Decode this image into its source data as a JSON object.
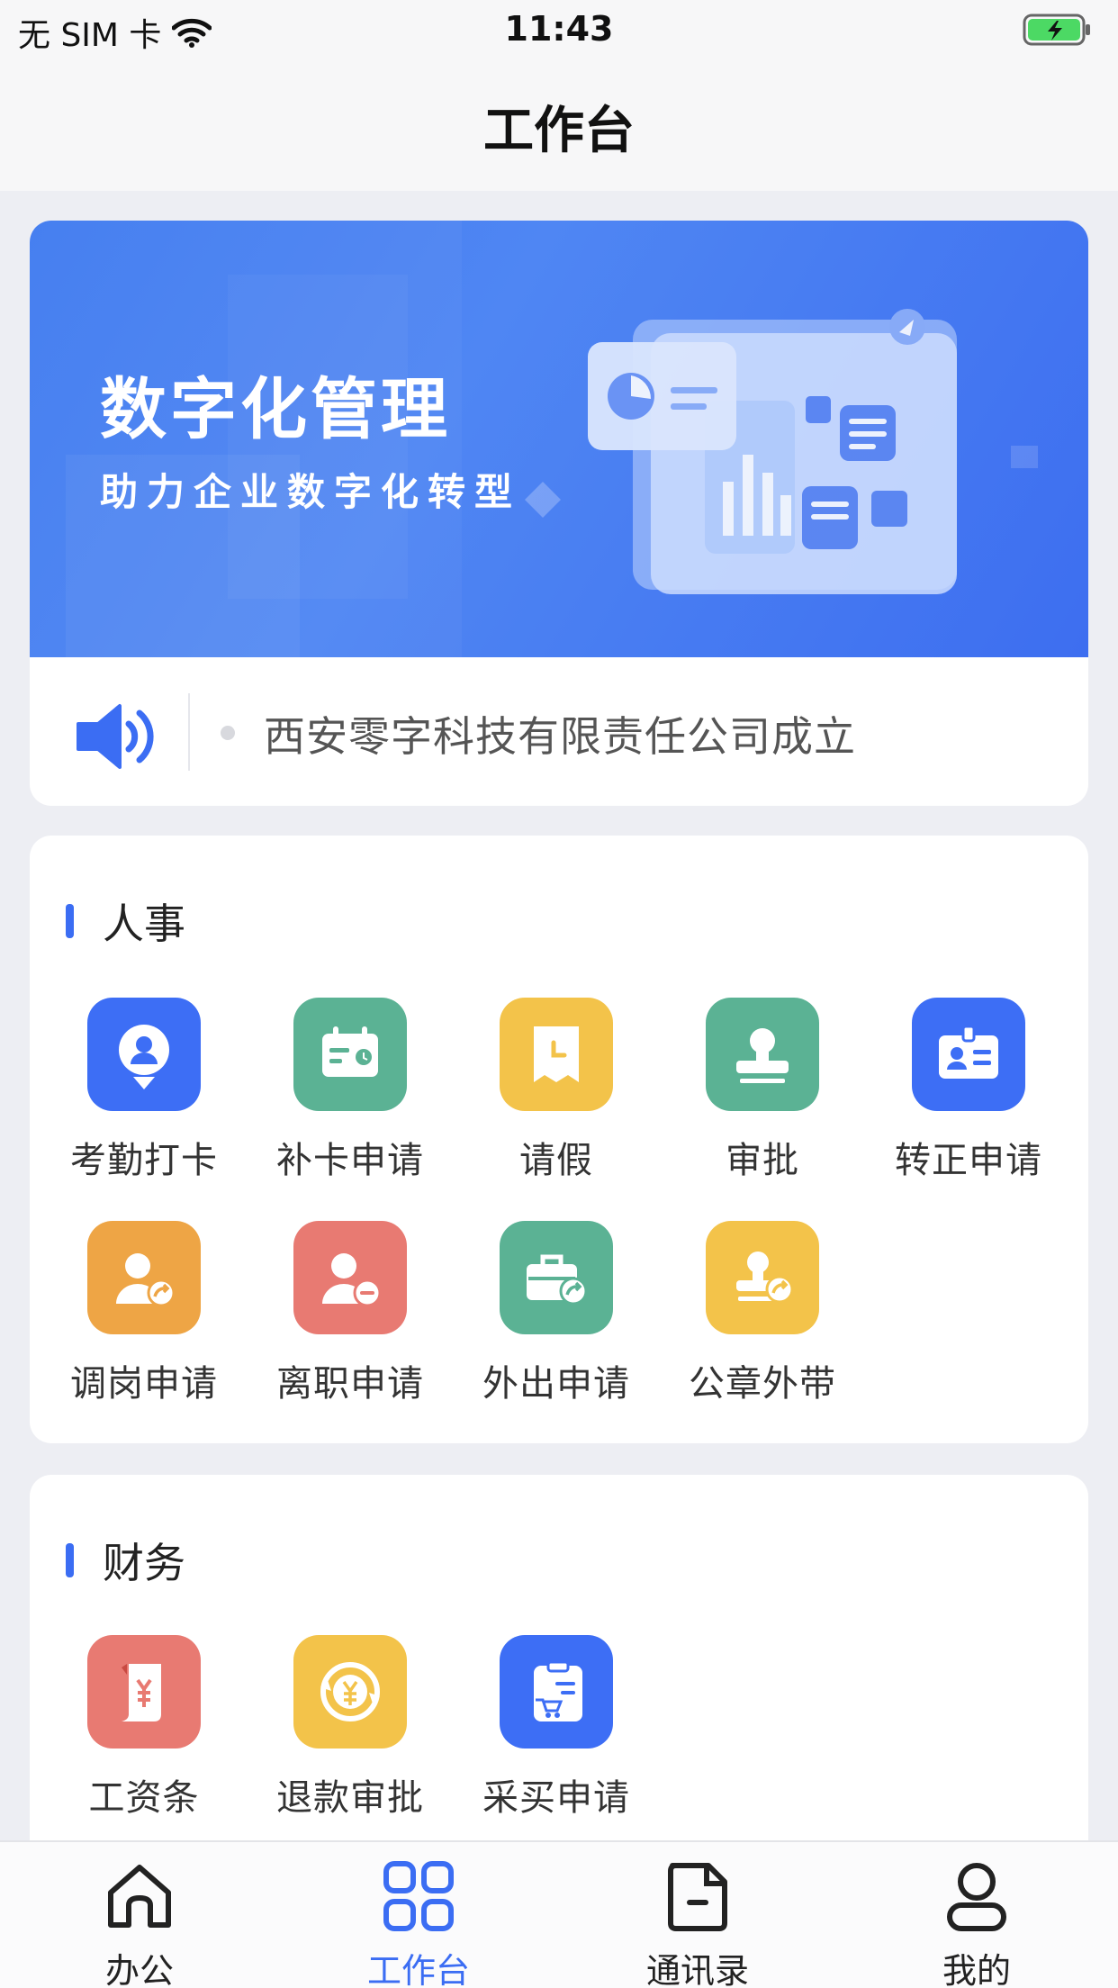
{
  "status_bar": {
    "carrier": "无 SIM 卡",
    "time": "11:43"
  },
  "header": {
    "title": "工作台"
  },
  "banner": {
    "title": "数字化管理",
    "subtitle": "助力企业数字化转型"
  },
  "notice": {
    "text": "西安零字科技有限责任公司成立"
  },
  "sections": {
    "hr": {
      "title": "人事",
      "items": [
        {
          "label": "考勤打卡",
          "color": "#3d6ef5",
          "icon": "location-person-icon"
        },
        {
          "label": "补卡申请",
          "color": "#5bb294",
          "icon": "calendar-card-icon"
        },
        {
          "label": "请假",
          "color": "#f3c34a",
          "icon": "leave-clock-icon"
        },
        {
          "label": "审批",
          "color": "#5bb294",
          "icon": "stamp-icon"
        },
        {
          "label": "转正申请",
          "color": "#3d6ef5",
          "icon": "id-badge-icon"
        },
        {
          "label": "调岗申请",
          "color": "#eea545",
          "icon": "person-transfer-icon"
        },
        {
          "label": "离职申请",
          "color": "#e87a72",
          "icon": "person-leave-icon"
        },
        {
          "label": "外出申请",
          "color": "#5bb294",
          "icon": "briefcase-out-icon"
        },
        {
          "label": "公章外带",
          "color": "#f3c34a",
          "icon": "seal-out-icon"
        }
      ]
    },
    "finance": {
      "title": "财务",
      "items": [
        {
          "label": "工资条",
          "color": "#e87a72",
          "icon": "payslip-icon"
        },
        {
          "label": "退款审批",
          "color": "#f3c34a",
          "icon": "refund-icon"
        },
        {
          "label": "采买申请",
          "color": "#3d6ef5",
          "icon": "purchase-icon"
        }
      ]
    }
  },
  "tabbar": {
    "active_color": "#3b6df3",
    "tabs": [
      {
        "label": "办公",
        "icon": "home-icon"
      },
      {
        "label": "工作台",
        "icon": "grid-icon"
      },
      {
        "label": "通讯录",
        "icon": "contacts-icon"
      },
      {
        "label": "我的",
        "icon": "profile-icon"
      }
    ]
  }
}
